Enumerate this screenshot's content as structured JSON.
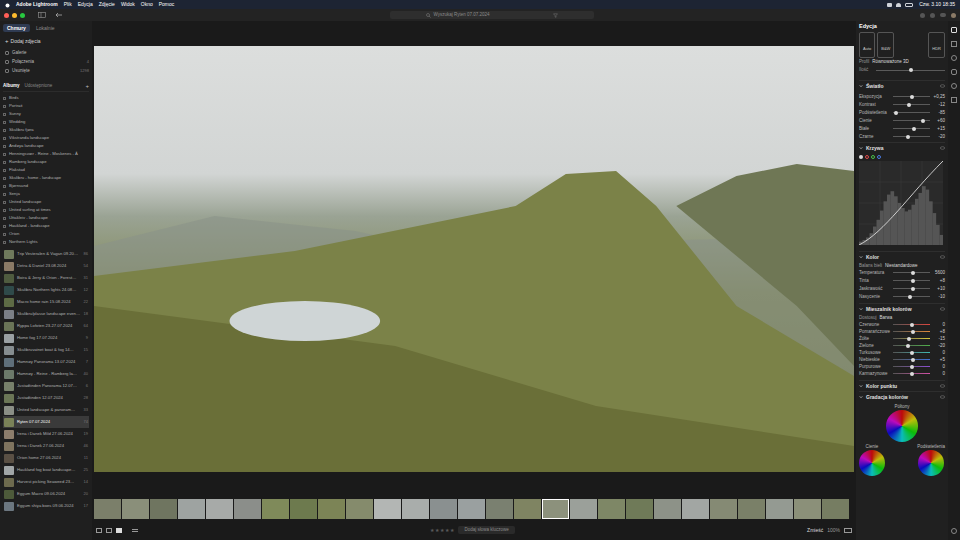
{
  "menubar": {
    "app": "Adobe Lightroom",
    "items": [
      "Plik",
      "Edycja",
      "Zdjęcie",
      "Widok",
      "Okno",
      "Pomoc"
    ],
    "clock": "Czw. 3.10 18:35"
  },
  "toolbar": {
    "search": "Wyszukaj Ryten 07.07.2024"
  },
  "sidebar": {
    "tabs": [
      {
        "label": "Chmury",
        "selected": true
      },
      {
        "label": "Lokalnie",
        "selected": false
      }
    ],
    "add": "Dodaj zdjęcia",
    "nav": [
      {
        "label": "Galerie",
        "count": ""
      },
      {
        "label": "Połączenia",
        "count": "4"
      },
      {
        "label": "Usunięte",
        "count": "1298"
      }
    ],
    "albumTabs": [
      {
        "label": "Albumy",
        "selected": true
      },
      {
        "label": "Udostępnione",
        "selected": false
      }
    ],
    "addGlyph": "+",
    "folders": [
      "Birds",
      "Portrait",
      "Sunny",
      "Wedding",
      "Skulibru fjøra",
      "Vikstranda landscape",
      "Andøya landscape",
      "Henningsvær - Reine - Moskenes - Å",
      "Ramberg landscape",
      "Flakstad",
      "Skulibru - home - landscape",
      "Bjørnsund",
      "Senja",
      "United landscape",
      "United surfing at times",
      "Uttakleiv - landscape",
      "Haukland - landscape",
      "Orion",
      "Northern Lights"
    ],
    "albums": [
      {
        "label": "Trip Vesterålen & Vågan 09.20…",
        "count": "86",
        "color": "#6f7a5c",
        "selected": false
      },
      {
        "label": "Detra & Daniel 23.08.2024",
        "count": "54",
        "color": "#8a7a66",
        "selected": false
      },
      {
        "label": "Boira & Jerry & Orion - Forest…",
        "count": "31",
        "color": "#4f5b3f",
        "selected": false
      },
      {
        "label": "Skulibru Northern lights 24.08…",
        "count": "12",
        "color": "#2f4a4a",
        "selected": false
      },
      {
        "label": "Macro home rain 15.08.2024",
        "count": "22",
        "color": "#5d6b45",
        "selected": false
      },
      {
        "label": "Skulibru/plasse landscape even…",
        "count": "18",
        "color": "#7b7f86",
        "selected": false
      },
      {
        "label": "Ryppa Lofoten 23-27.07.2024",
        "count": "64",
        "color": "#6a7457",
        "selected": false
      },
      {
        "label": "Home fog 17.07.2024",
        "count": "9",
        "color": "#9aa0a3",
        "selected": false
      },
      {
        "label": "Skulibruvatnet boat & fog 14…",
        "count": "15",
        "color": "#868d90",
        "selected": false
      },
      {
        "label": "Hamnøy Panorama 13.07.2024",
        "count": "7",
        "color": "#5f6f7a",
        "selected": false
      },
      {
        "label": "Hamnøy - Reine - Ramberg la…",
        "count": "40",
        "color": "#6c7a6a",
        "selected": false
      },
      {
        "label": "Justadtinden Panorama 12.07…",
        "count": "6",
        "color": "#77806a",
        "selected": false
      },
      {
        "label": "Justadtinden 12.07.2024",
        "count": "28",
        "color": "#6b7656",
        "selected": false
      },
      {
        "label": "United landscape & panoram…",
        "count": "33",
        "color": "#8b8f86",
        "selected": false
      },
      {
        "label": "Ryten 07.07.2024",
        "count": "74",
        "color": "#7a8258",
        "selected": true
      },
      {
        "label": "Irena i Danek Mild 27.06.2024",
        "count": "19",
        "color": "#8c7d6c",
        "selected": false
      },
      {
        "label": "Irena i Danek 27.06.2024",
        "count": "46",
        "color": "#7f745f",
        "selected": false
      },
      {
        "label": "Orion home 27.06.2024",
        "count": "11",
        "color": "#5a5044",
        "selected": false
      },
      {
        "label": "Haukland fog boat landscape…",
        "count": "25",
        "color": "#a1a6a7",
        "selected": false
      },
      {
        "label": "Harvest picking Seaweed 23…",
        "count": "14",
        "color": "#6d6a4e",
        "selected": false
      },
      {
        "label": "Eggum Macro 09.06.2024",
        "count": "20",
        "color": "#4d5a3a",
        "selected": false
      },
      {
        "label": "Eggum shiya boes 09.06.2024",
        "count": "17",
        "color": "#6c7780",
        "selected": false
      }
    ]
  },
  "filmstrip": [
    {
      "color": "#7b7f6a",
      "selected": false
    },
    {
      "color": "#8a8f7a",
      "selected": false
    },
    {
      "color": "#6f7560",
      "selected": false
    },
    {
      "color": "#9ea3a1",
      "selected": false
    },
    {
      "color": "#a7aaa8",
      "selected": false
    },
    {
      "color": "#8b8e8a",
      "selected": false
    },
    {
      "color": "#7f8a5a",
      "selected": false
    },
    {
      "color": "#6d7a4e",
      "selected": false
    },
    {
      "color": "#7c8456",
      "selected": false
    },
    {
      "color": "#858b6c",
      "selected": false
    },
    {
      "color": "#b3b6b4",
      "selected": false
    },
    {
      "color": "#a9adab",
      "selected": false
    },
    {
      "color": "#8a9090",
      "selected": false
    },
    {
      "color": "#9aa0a0",
      "selected": false
    },
    {
      "color": "#7a8070",
      "selected": false
    },
    {
      "color": "#7f8462",
      "selected": false
    },
    {
      "color": "#8c917c",
      "selected": true
    },
    {
      "color": "#9ba09a",
      "selected": false
    },
    {
      "color": "#7e8766",
      "selected": false
    },
    {
      "color": "#6f7a58",
      "selected": false
    },
    {
      "color": "#8d9288",
      "selected": false
    },
    {
      "color": "#a2a6a3",
      "selected": false
    },
    {
      "color": "#858a74",
      "selected": false
    },
    {
      "color": "#7a8068",
      "selected": false
    },
    {
      "color": "#949a92",
      "selected": false
    },
    {
      "color": "#8b9079",
      "selected": false
    },
    {
      "color": "#767d62",
      "selected": false
    }
  ],
  "bottombar": {
    "rating": {
      "glyph": "★",
      "stars": 0,
      "max": 5
    },
    "keywords": "Dodaj słowa kluczowe",
    "fit": "Zmieść",
    "zoom": "100%"
  },
  "edit": {
    "title": "Edycja",
    "modes": [
      "Auto",
      "B&W"
    ],
    "hdr": "HDR",
    "profileLabel": "Profil",
    "profileValue": "Równoważone 3D",
    "amountLabel": "Ilość",
    "amount": 0.5,
    "light": {
      "title": "Światło",
      "sliders": [
        {
          "label": "Ekspozycja",
          "value": "+0,25",
          "level": 0.52
        },
        {
          "label": "Kontrast",
          "value": "-12",
          "level": 0.44
        },
        {
          "label": "Podświetlenia",
          "value": "-85",
          "level": 0.08
        },
        {
          "label": "Cienie",
          "value": "+60",
          "level": 0.8
        },
        {
          "label": "Białe",
          "value": "+15",
          "level": 0.57
        },
        {
          "label": "Czarne",
          "value": "-20",
          "level": 0.4
        }
      ]
    },
    "curve": {
      "title": "Krzywa",
      "histogram": [
        4,
        6,
        9,
        14,
        22,
        30,
        41,
        52,
        60,
        64,
        58,
        50,
        44,
        40,
        42,
        48,
        55,
        62,
        70,
        66,
        52,
        38,
        24,
        12
      ]
    },
    "color": {
      "title": "Kolor",
      "wbLabel": "Balans bieli",
      "wbValue": "Niestandardowe",
      "sliders": [
        {
          "label": "Temperatura",
          "value": "5600",
          "level": 0.55
        },
        {
          "label": "Tinta",
          "value": "+8",
          "level": 0.53
        },
        {
          "label": "Jaskrawość",
          "value": "+10",
          "level": 0.55
        },
        {
          "label": "Nasycenie",
          "value": "-10",
          "level": 0.45
        }
      ]
    },
    "mixer": {
      "title": "Mieszalnik kolorów",
      "adjustLabel": "Dostosuj",
      "adjustValue": "Barwa",
      "sliders": [
        {
          "label": "Czerwone",
          "value": "0",
          "level": 0.5,
          "color": "#d9463e"
        },
        {
          "label": "Pomarańczowe",
          "value": "+8",
          "level": 0.54,
          "color": "#e0873a"
        },
        {
          "label": "Żółte",
          "value": "-15",
          "level": 0.42,
          "color": "#d8c83c"
        },
        {
          "label": "Zielone",
          "value": "-20",
          "level": 0.4,
          "color": "#4fae4a"
        },
        {
          "label": "Turkusowe",
          "value": "0",
          "level": 0.5,
          "color": "#3fb6b0"
        },
        {
          "label": "Niebieskie",
          "value": "+5",
          "level": 0.53,
          "color": "#3f6fd6"
        },
        {
          "label": "Purpurowe",
          "value": "0",
          "level": 0.5,
          "color": "#8a4fd0"
        },
        {
          "label": "Karmazynowe",
          "value": "0",
          "level": 0.5,
          "color": "#d04fa6"
        }
      ]
    },
    "pointColor": "Kolor punktu",
    "grading": {
      "title": "Gradacja kolorów",
      "wheels": [
        "Półtony",
        "Cienie",
        "Podświetlenia"
      ]
    }
  }
}
